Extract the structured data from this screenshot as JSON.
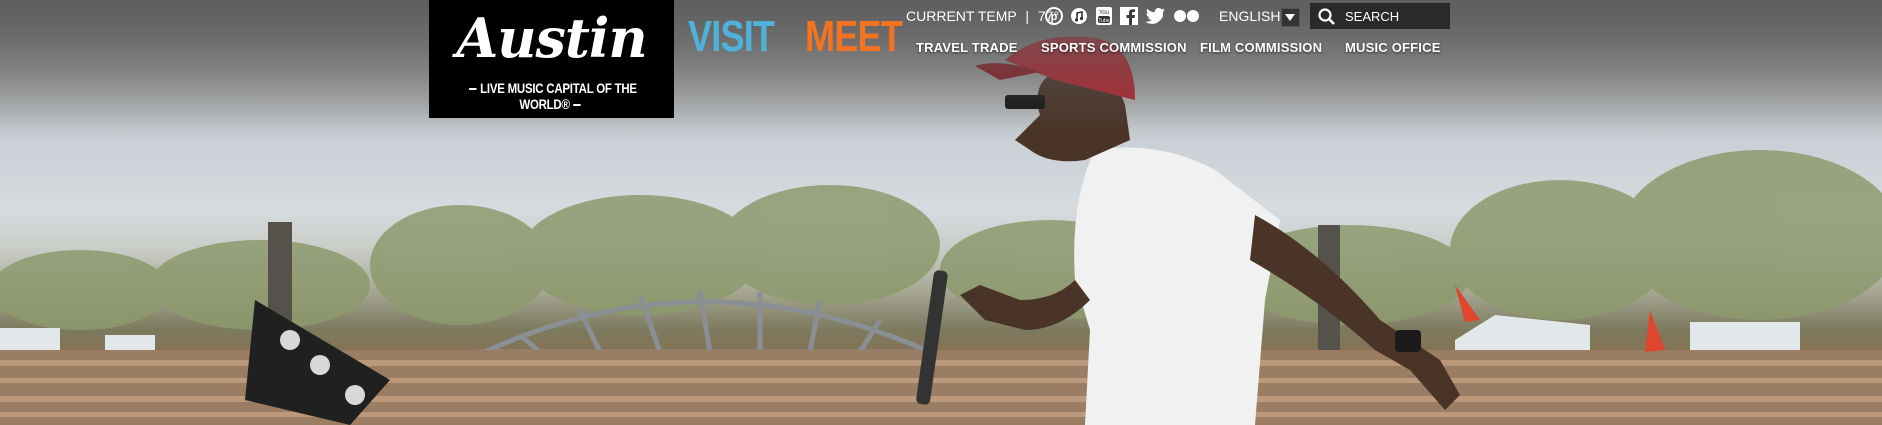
{
  "logo": {
    "wordmark": "Austin",
    "tagline": "LIVE MUSIC CAPITAL OF THE WORLD®"
  },
  "nav": {
    "visit": "VISIT",
    "meet": "MEET"
  },
  "utility": {
    "temp_label": "CURRENT TEMP",
    "separator": "|",
    "temp_value": "77°",
    "language": "ENGLISH",
    "search_placeholder": "SEARCH"
  },
  "social_icons": [
    "pinterest-icon",
    "music-icon",
    "youtube-icon",
    "facebook-icon",
    "twitter-icon",
    "flickr-icon"
  ],
  "subnav": {
    "travel_trade": "TRAVEL TRADE",
    "sports_commission": "SPORTS COMMISSION",
    "film_commission": "FILM COMMISSION",
    "music_office": "MUSIC OFFICE"
  },
  "colors": {
    "visit": "#4fb3d9",
    "meet": "#f47321",
    "logo_bg": "#000000"
  }
}
